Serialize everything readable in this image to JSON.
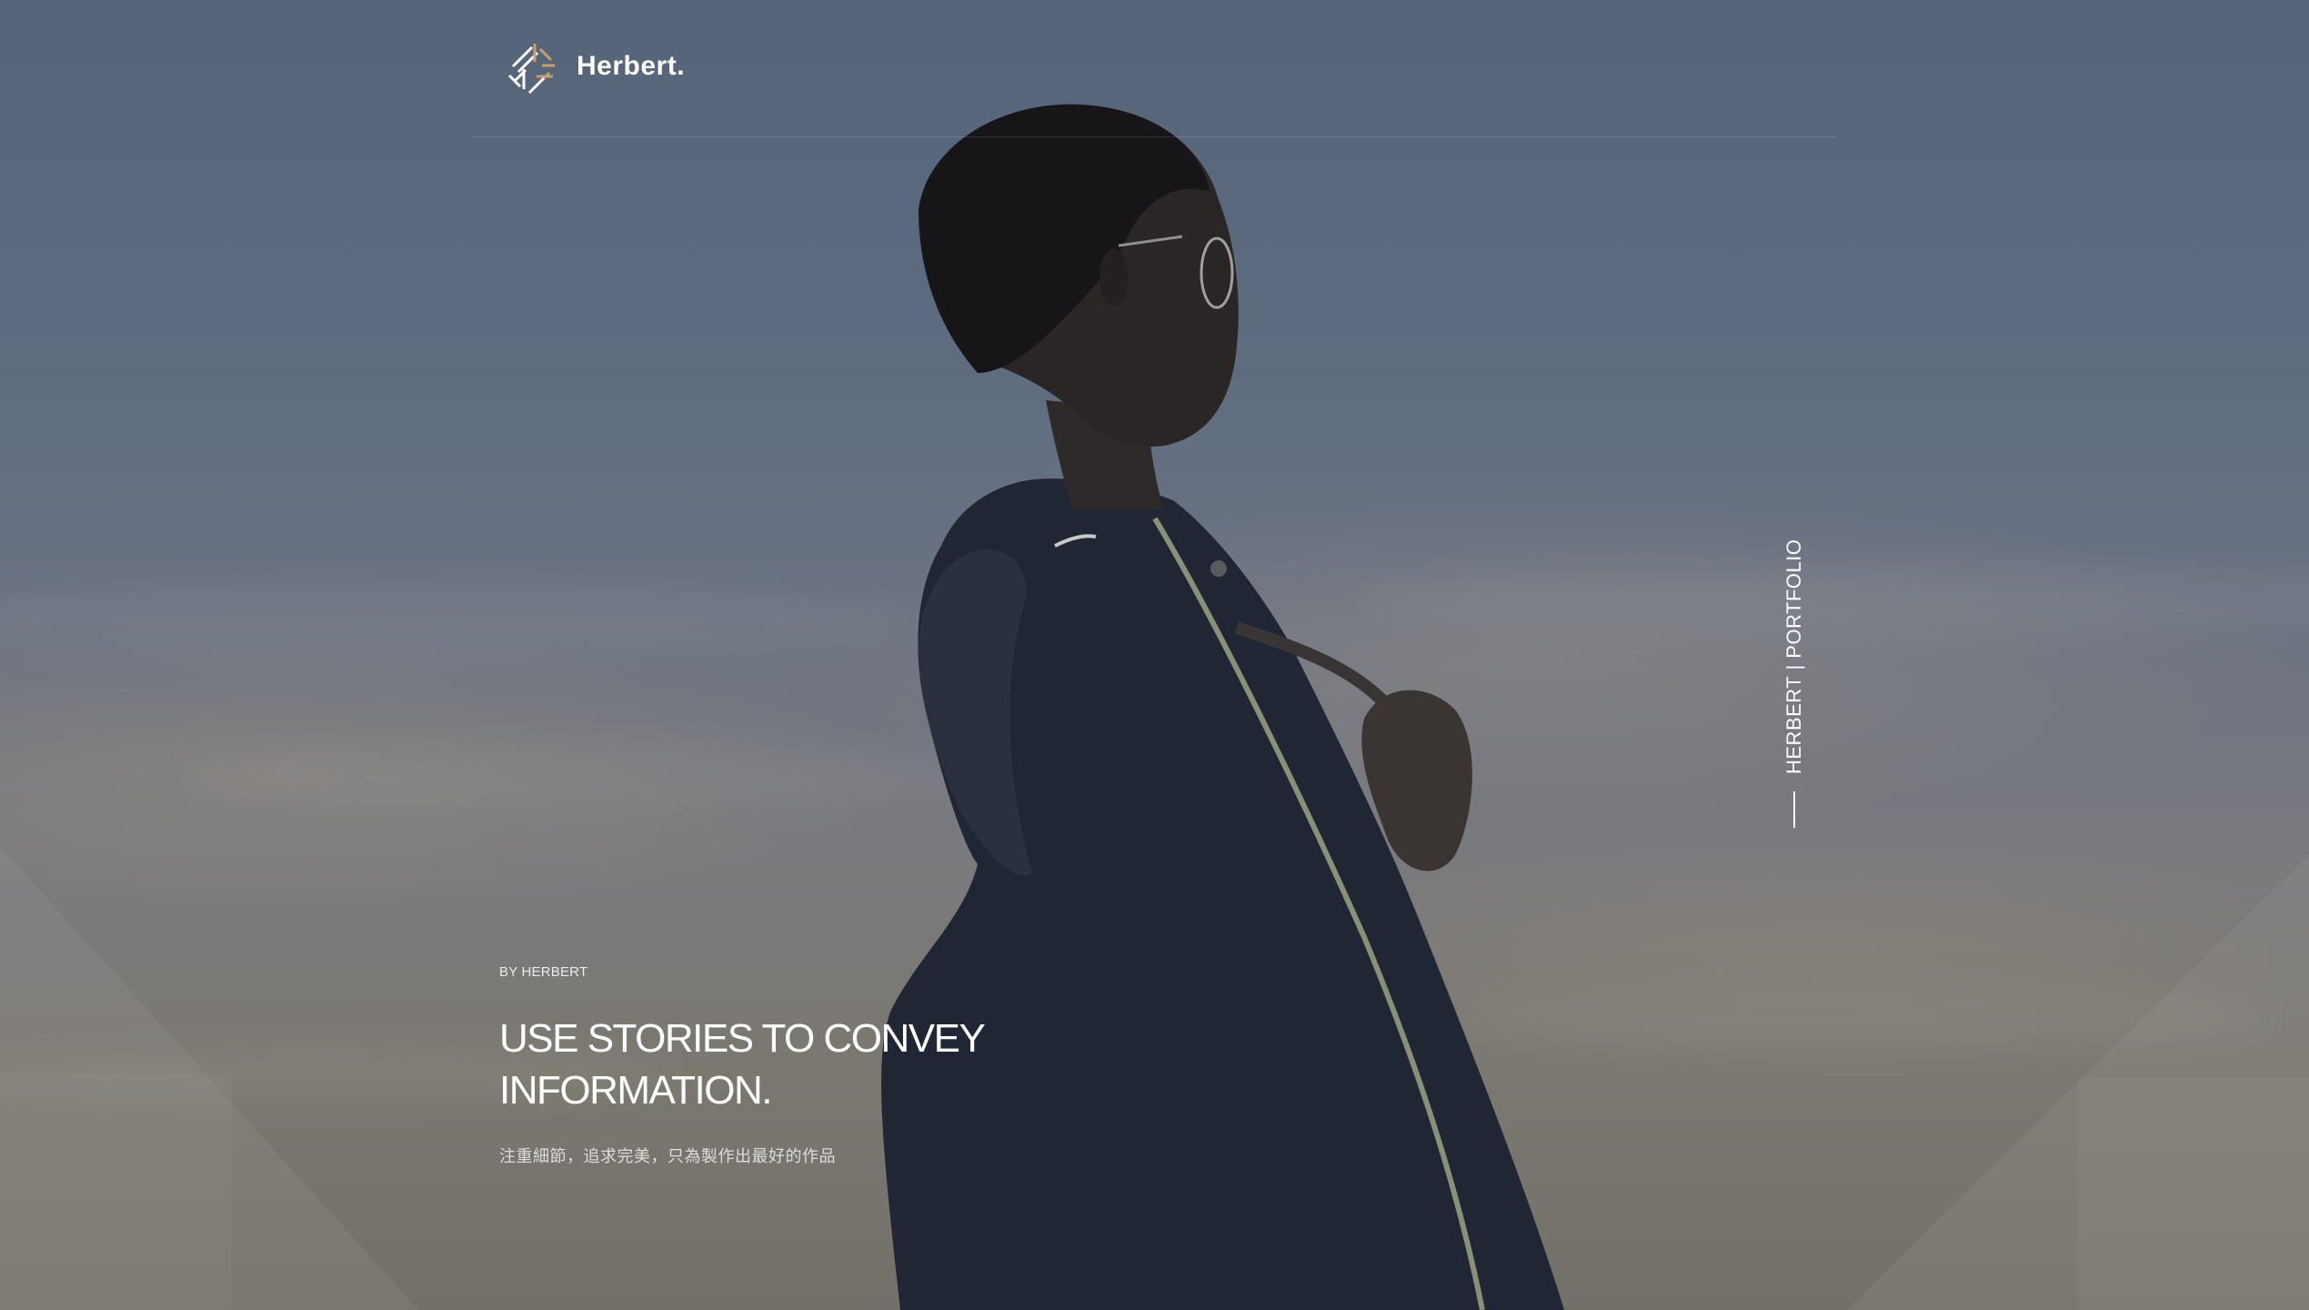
{
  "brand": {
    "logo_icon": "herbert-logo-icon",
    "name": "Herbert."
  },
  "side_label": {
    "text": "HERBERT | PORTFOLIO"
  },
  "hero": {
    "byline": "BY HERBERT",
    "headline_line1": "USE STORIES TO CONVEY",
    "headline_line2": "INFORMATION.",
    "subline": "注重細節，追求完美，只為製作出最好的作品"
  },
  "colors": {
    "overlay": "#566579",
    "text": "#ffffff",
    "logo_gold": "#c9a06a",
    "logo_white": "#ffffff"
  }
}
